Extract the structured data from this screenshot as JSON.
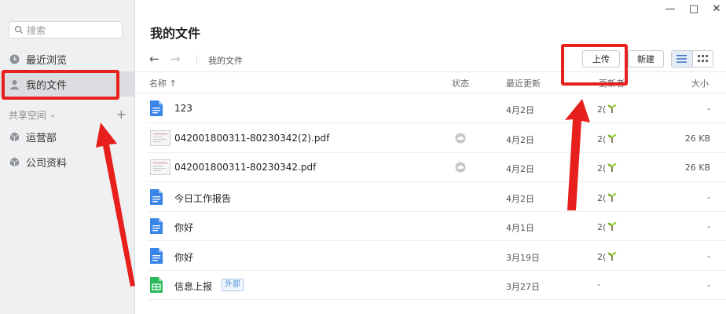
{
  "window": {
    "minimize_glyph": "—",
    "maximize_glyph": "□",
    "close_glyph": "✕"
  },
  "sidebar": {
    "search_placeholder": "搜索",
    "items": [
      {
        "label": "最近浏览",
        "icon": "clock-icon",
        "active": false
      },
      {
        "label": "我的文件",
        "icon": "user-icon",
        "active": true
      }
    ],
    "shared_section": {
      "title": "共享空间",
      "add_glyph": "+"
    },
    "shared_items": [
      {
        "label": "运营部",
        "icon": "cube-icon"
      },
      {
        "label": "公司资料",
        "icon": "cube-icon"
      }
    ]
  },
  "main": {
    "title": "我的文件",
    "back_glyph": "←",
    "forward_glyph": "→",
    "breadcrumb": "我的文件",
    "upload_label": "上传",
    "new_label": "新建"
  },
  "table": {
    "headers": {
      "name": "名称 ↑",
      "status": "状态",
      "updated": "最近更新",
      "updater": "更新者",
      "size": "大小"
    },
    "rows": [
      {
        "name": "123",
        "type": "doc",
        "status": "",
        "date": "4月2日",
        "updater": "2(",
        "size": "-",
        "tag": ""
      },
      {
        "name": "042001800311-80230342(2).pdf",
        "type": "pdf",
        "status": "cloud",
        "date": "4月2日",
        "updater": "2(",
        "size": "26 KB",
        "tag": ""
      },
      {
        "name": "042001800311-80230342.pdf",
        "type": "pdf",
        "status": "cloud",
        "date": "4月2日",
        "updater": "2(",
        "size": "26 KB",
        "tag": ""
      },
      {
        "name": "今日工作报告",
        "type": "doc",
        "status": "",
        "date": "4月2日",
        "updater": "2(",
        "size": "-",
        "tag": ""
      },
      {
        "name": "你好",
        "type": "doc",
        "status": "",
        "date": "4月1日",
        "updater": "2(",
        "size": "-",
        "tag": ""
      },
      {
        "name": "你好",
        "type": "doc",
        "status": "",
        "date": "3月19日",
        "updater": "2(",
        "size": "-",
        "tag": ""
      },
      {
        "name": "信息上报",
        "type": "sheet",
        "status": "",
        "date": "3月27日",
        "updater": "-",
        "size": "-",
        "tag": "外部"
      }
    ]
  },
  "colors": {
    "annotation_red": "#e8201d",
    "doc_blue": "#3a86e8",
    "sheet_green": "#2dbb5d",
    "active_bg": "#dcdde0"
  }
}
